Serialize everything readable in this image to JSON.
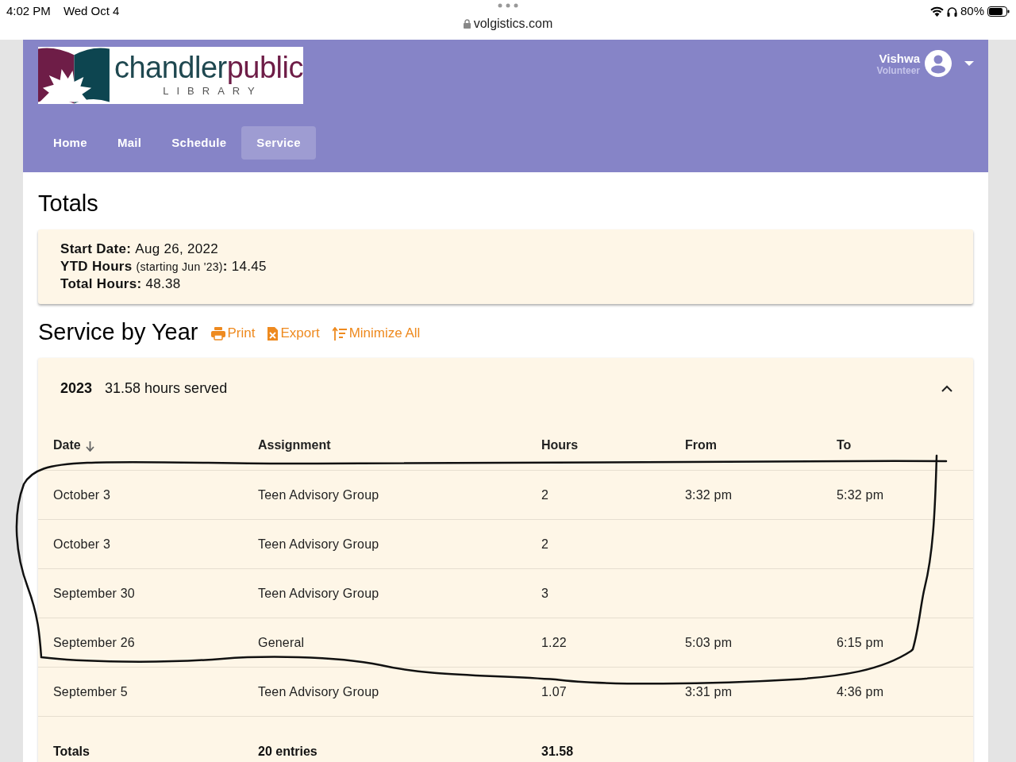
{
  "status_bar": {
    "time": "4:02 PM",
    "date": "Wed Oct 4",
    "url": "volgistics.com",
    "battery": "80%"
  },
  "logo": {
    "word_1": "chandler",
    "word_2": "public",
    "subtitle": "LIBRARY"
  },
  "user": {
    "name": "Vishwa",
    "role": "Volunteer"
  },
  "nav": [
    {
      "label": "Home",
      "selected": false
    },
    {
      "label": "Mail",
      "selected": false
    },
    {
      "label": "Schedule",
      "selected": false
    },
    {
      "label": "Service",
      "selected": true
    }
  ],
  "totals": {
    "title": "Totals",
    "lines": [
      {
        "label": "Start Date:",
        "value": "Aug 26, 2022"
      },
      {
        "label": "YTD Hours",
        "note": "(starting Jun '23)",
        "suffix": ":",
        "value": "14.45"
      },
      {
        "label": "Total Hours:",
        "value": "48.38"
      }
    ]
  },
  "service": {
    "title": "Service by Year",
    "actions": [
      {
        "kind": "print",
        "label": "Print"
      },
      {
        "kind": "export",
        "label": "Export"
      },
      {
        "kind": "minimize",
        "label": "Minimize All"
      }
    ],
    "years": [
      {
        "year": "2023",
        "summary": "31.58 hours served",
        "expanded": true,
        "columns": [
          {
            "label": "Date",
            "sorted": true
          },
          {
            "label": "Assignment",
            "sorted": false
          },
          {
            "label": "Hours",
            "sorted": false
          },
          {
            "label": "From",
            "sorted": false
          },
          {
            "label": "To",
            "sorted": false
          }
        ],
        "rows": [
          [
            "October 3",
            "Teen Advisory Group",
            "2",
            "3:32 pm",
            "5:32 pm"
          ],
          [
            "October 3",
            "Teen Advisory Group",
            "2",
            "",
            ""
          ],
          [
            "September 30",
            "Teen Advisory Group",
            "3",
            "",
            ""
          ],
          [
            "September 26",
            "General",
            "1.22",
            "5:03 pm",
            "6:15 pm"
          ],
          [
            "September 5",
            "Teen Advisory Group",
            "1.07",
            "3:31 pm",
            "4:36 pm"
          ]
        ],
        "totals": [
          "Totals",
          "20 entries",
          "31.58"
        ]
      }
    ]
  }
}
